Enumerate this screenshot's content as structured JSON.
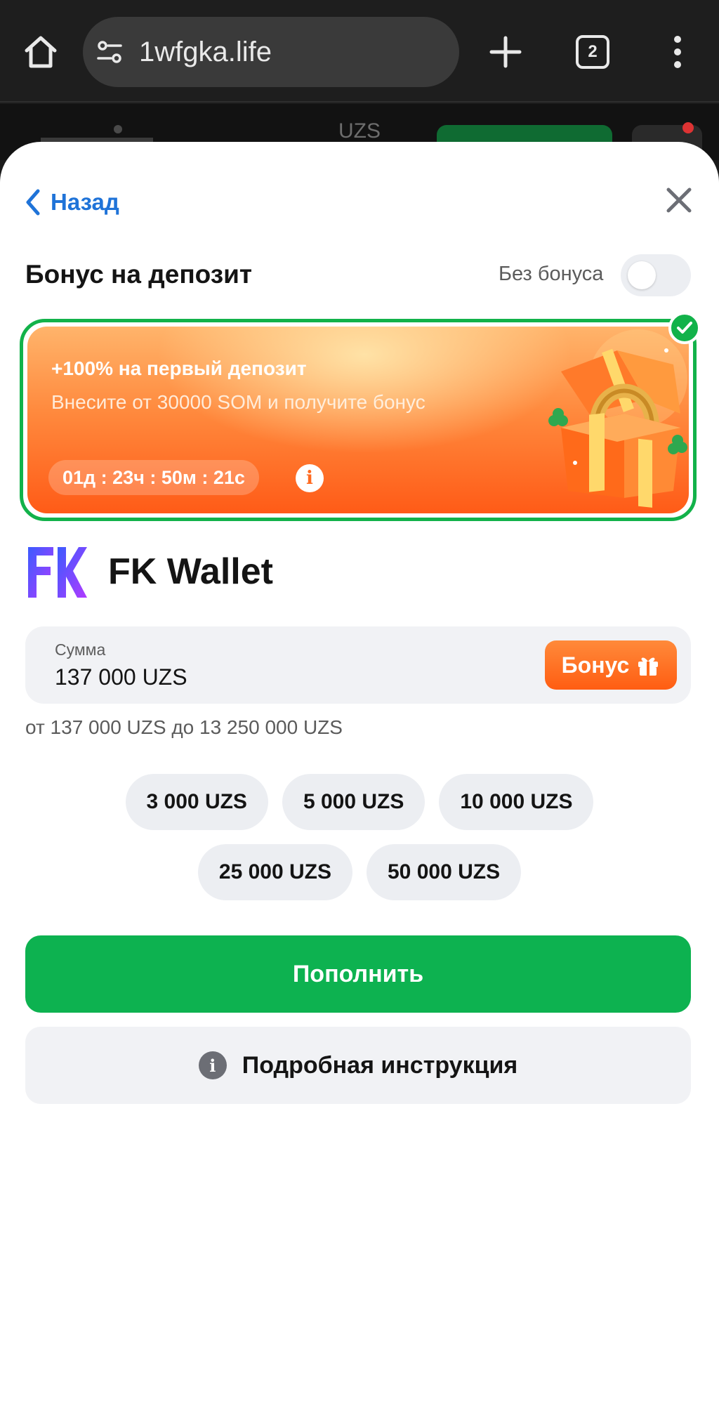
{
  "browser": {
    "url": "1wfgka.life",
    "tab_count": "2"
  },
  "site_header": {
    "currency": "UZS"
  },
  "modal": {
    "back_label": "Назад",
    "bonus_title": "Бонус на депозит",
    "no_bonus_label": "Без бонуса",
    "no_bonus_enabled": false,
    "promo": {
      "title": "+100% на первый депозит",
      "subtitle": "Внесите от 30000 SOM и получите бонус",
      "timer": "01д : 23ч : 50м : 21с",
      "selected": true
    },
    "wallet_name": "FK Wallet",
    "amount": {
      "label": "Сумма",
      "value": "137 000 UZS",
      "bonus_chip": "Бонус"
    },
    "range": "от 137 000 UZS до 13 250 000 UZS",
    "quick_amounts_row1": [
      "3 000 UZS",
      "5 000 UZS",
      "10 000 UZS"
    ],
    "quick_amounts_row2": [
      "25 000 UZS",
      "50 000 UZS"
    ],
    "submit_label": "Пополнить",
    "instruction_label": "Подробная инструкция"
  },
  "colors": {
    "accent_green": "#0db250",
    "link_blue": "#1f73d8",
    "promo_orange": "#ff5b17"
  }
}
